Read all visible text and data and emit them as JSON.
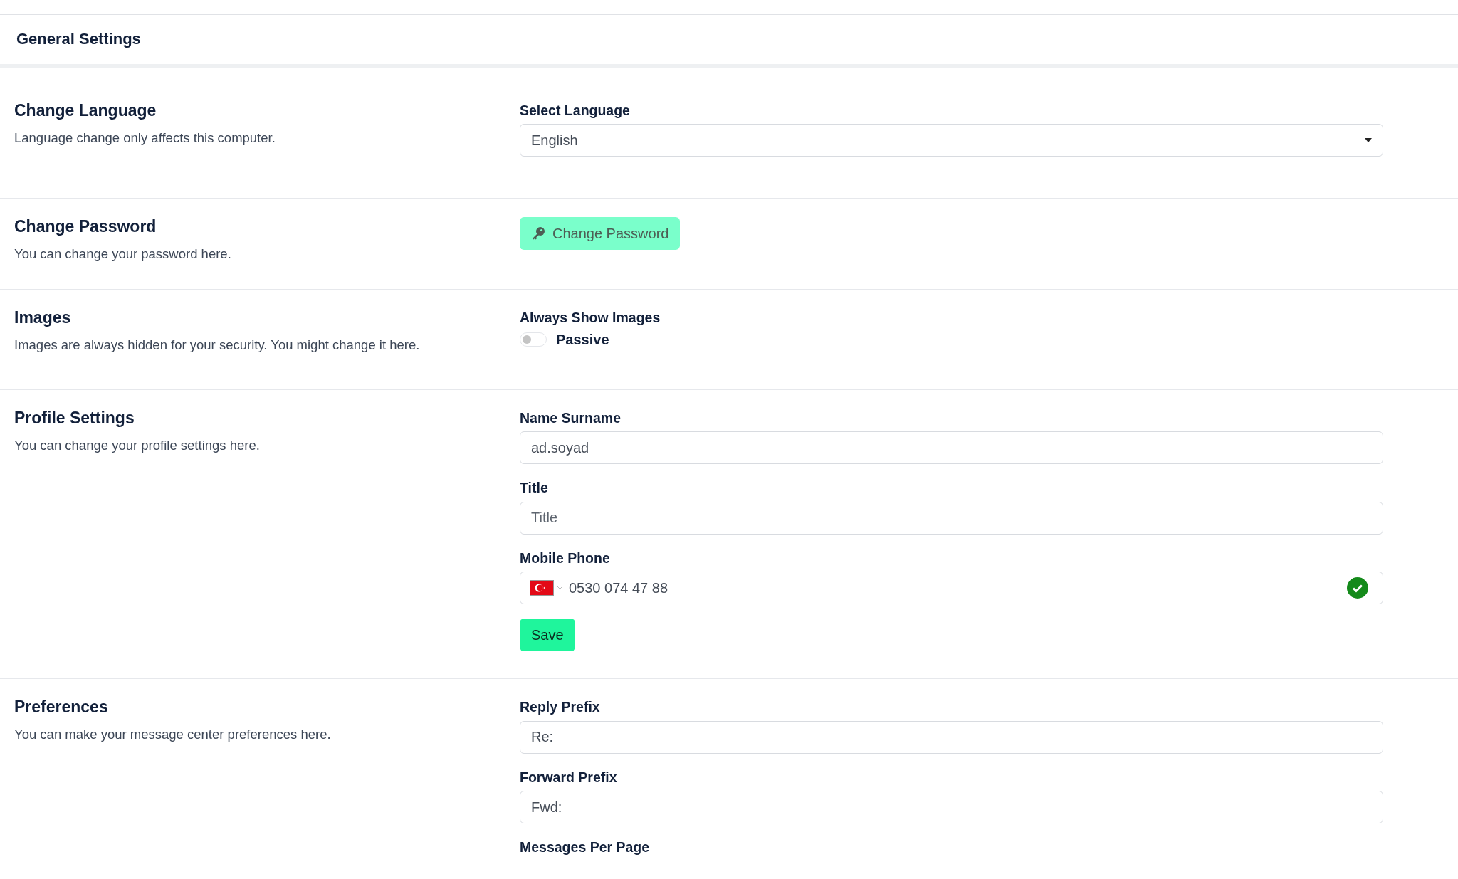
{
  "header": {
    "title": "General Settings"
  },
  "sections": [
    {
      "title": "Change Language",
      "description": "Language change only affects this computer.",
      "controls": [
        {
          "kind": "select",
          "label": "Select Language",
          "value": "English"
        }
      ]
    },
    {
      "title": "Change Password",
      "description": "You can change your password here.",
      "controls": [
        {
          "kind": "action",
          "label": "Change Password"
        }
      ]
    },
    {
      "title": "Images",
      "description": "Images are always hidden for your security. You might change it here.",
      "controls": [
        {
          "kind": "toggle",
          "label": "Always Show Images",
          "on": false,
          "state_label": "Passive"
        }
      ]
    },
    {
      "title": "Profile Settings",
      "description": "You can change your profile settings here.",
      "controls": [
        {
          "kind": "field",
          "label": "Name Surname",
          "value": "ad.soyad"
        },
        {
          "kind": "field",
          "label": "Title",
          "placeholder": "Title"
        },
        {
          "kind": "phone",
          "label": "Mobile Phone",
          "value": "0530 074 47 88",
          "valid": true
        },
        {
          "kind": "submit",
          "label": "Save"
        }
      ]
    },
    {
      "title": "Preferences",
      "description": "You can make your message center preferences here.",
      "controls": [
        {
          "kind": "field",
          "label": "Reply Prefix",
          "value": "Re:"
        },
        {
          "kind": "field",
          "label": "Forward Prefix",
          "value": "Fwd:"
        },
        {
          "kind": "label",
          "label": "Messages Per Page"
        }
      ]
    }
  ]
}
